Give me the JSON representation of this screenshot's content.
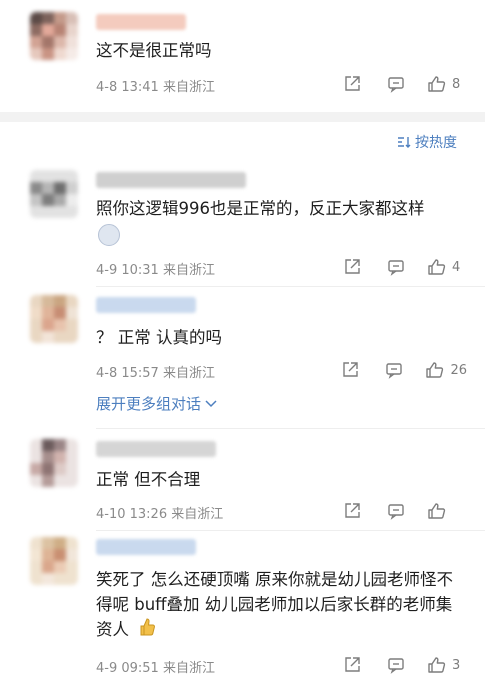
{
  "pinned": {
    "text": "这不是很正常吗",
    "time": "4-8 13:41",
    "location": "来自浙江",
    "likes": "8"
  },
  "sort": {
    "label": "按热度",
    "icon": "sort-icon"
  },
  "comments": [
    {
      "text": "照你这逻辑996也是正常的，反正大家都这样",
      "emoji": "surprised-face-emoji",
      "time": "4-9 10:31",
      "location": "来自浙江",
      "likes": "4"
    },
    {
      "text": "？ 正常 认真的吗",
      "time": "4-8 15:57",
      "location": "来自浙江",
      "likes": "26",
      "expand_label": "展开更多组对话"
    },
    {
      "text": "正常 但不合理",
      "time": "4-10 13:26",
      "location": "来自浙江",
      "likes": ""
    },
    {
      "text": "笑死了 怎么还硬顶嘴 原来你就是幼儿园老师怪不得呢 buff叠加 幼儿园老师加以后家长群的老师集资人",
      "emoji": "thumbs-up-emoji",
      "time": "4-9 09:51",
      "location": "来自浙江",
      "likes": "3"
    }
  ],
  "icons": {
    "share": "share-icon",
    "reply": "reply-icon",
    "like": "like-icon",
    "expand": "chevron-down-icon"
  },
  "colors": {
    "link": "#4d7fbf",
    "meta": "#8a8a8a",
    "divider": "#f2f2f2"
  }
}
